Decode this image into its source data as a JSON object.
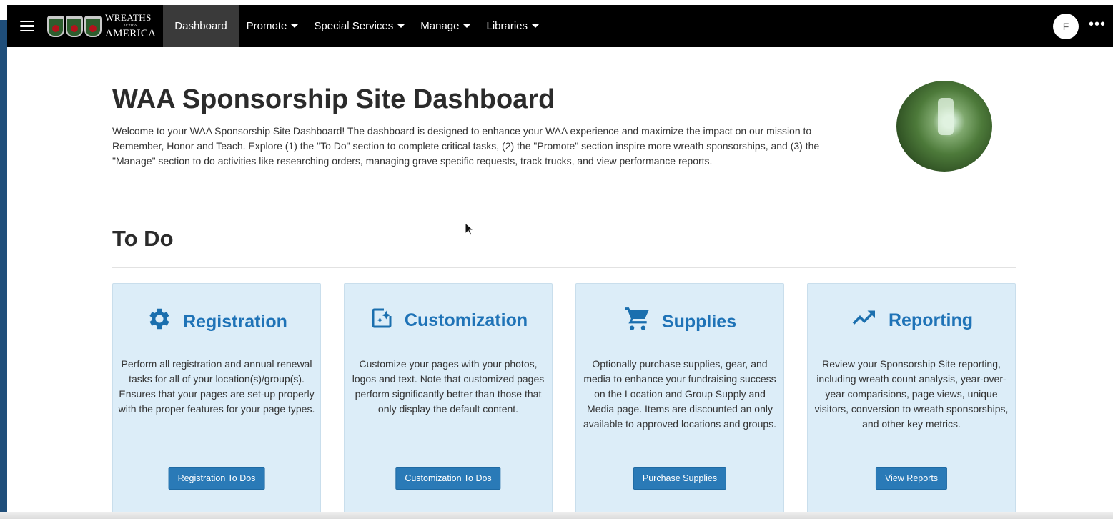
{
  "navbar": {
    "menu_icon": "hamburger-menu-icon",
    "logo": {
      "line1": "WREATHS",
      "line2": "across",
      "line3": "AMERICA"
    },
    "items": [
      {
        "label": "Dashboard",
        "active": true,
        "dropdown": false
      },
      {
        "label": "Promote",
        "dropdown": true
      },
      {
        "label": "Special Services",
        "dropdown": true
      },
      {
        "label": "Manage",
        "dropdown": true
      },
      {
        "label": "Libraries",
        "dropdown": true
      }
    ],
    "avatar_initial": "F",
    "more_icon": "more-dots-icon",
    "more_glyph": "•••"
  },
  "page": {
    "title": "WAA Sponsorship Site Dashboard",
    "intro": "Welcome to your WAA Sponsorship Site Dashboard! The dashboard is designed to enhance your WAA experience and maximize the impact on our mission to Remember, Honor and Teach. Explore (1) the \"To Do\" section to complete critical tasks, (2) the \"Promote\" section inspire more wreath sponsorships, and (3) the \"Manage\" section to do activities like researching orders, managing grave specific requests, track trucks, and view performance reports.",
    "section_title": "To Do"
  },
  "cards": [
    {
      "icon": "gear-icon",
      "title": "Registration",
      "text": "Perform all registration and annual renewal tasks for all of your location(s)/group(s). Ensures that your pages are set-up properly with the proper features for your page types.",
      "button": "Registration To Dos"
    },
    {
      "icon": "customize-image-icon",
      "title": "Customization",
      "text": "Customize your pages with your photos, logos and text. Note that customized pages perform significantly better than those that only display the default content.",
      "button": "Customization To Dos"
    },
    {
      "icon": "shopping-cart-icon",
      "title": "Supplies",
      "text": "Optionally purchase supplies, gear, and media to enhance your fundraising success on the Location and Group Supply and Media page. Items are discounted an only available to approved locations and groups.",
      "button": "Purchase Supplies"
    },
    {
      "icon": "trending-up-icon",
      "title": "Reporting",
      "text": "Review your Sponsorship Site reporting, including wreath count analysis, year-over-year comparisions, page views, unique visitors, conversion to wreath sponsorships, and other key metrics.",
      "button": "View Reports"
    }
  ],
  "colors": {
    "navbar_bg": "#000000",
    "active_nav_bg": "#3a3a3a",
    "card_bg": "#dcedf8",
    "accent_blue": "#1f73b7",
    "button_bg": "#2a7ab7"
  }
}
